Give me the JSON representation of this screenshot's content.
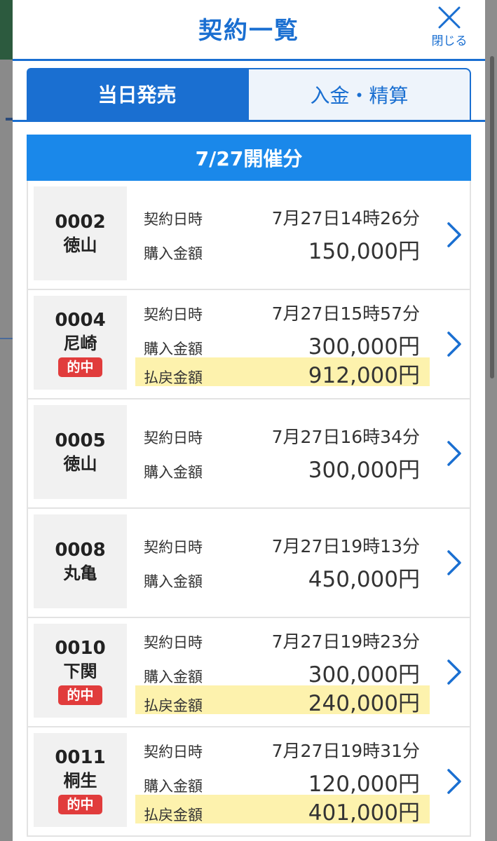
{
  "modal": {
    "title": "契約一覧",
    "close_label": "閉じる"
  },
  "tabs": [
    {
      "label": "当日発売",
      "active": true
    },
    {
      "label": "入金・精算",
      "active": false
    }
  ],
  "date_header": "7/27開催分",
  "labels": {
    "contract_datetime": "契約日時",
    "purchase_amount": "購入金額",
    "payout_amount": "払戻金額",
    "hit": "的中"
  },
  "contracts": [
    {
      "number": "0002",
      "venue": "徳山",
      "hit": false,
      "datetime": "7月27日14時26分",
      "purchase": "150,000円",
      "payout": null
    },
    {
      "number": "0004",
      "venue": "尼崎",
      "hit": true,
      "datetime": "7月27日15時57分",
      "purchase": "300,000円",
      "payout": "912,000円"
    },
    {
      "number": "0005",
      "venue": "徳山",
      "hit": false,
      "datetime": "7月27日16時34分",
      "purchase": "300,000円",
      "payout": null
    },
    {
      "number": "0008",
      "venue": "丸亀",
      "hit": false,
      "datetime": "7月27日19時13分",
      "purchase": "450,000円",
      "payout": null
    },
    {
      "number": "0010",
      "venue": "下関",
      "hit": true,
      "datetime": "7月27日19時23分",
      "purchase": "300,000円",
      "payout": "240,000円"
    },
    {
      "number": "0011",
      "venue": "桐生",
      "hit": true,
      "datetime": "7月27日19時31分",
      "purchase": "120,000円",
      "payout": "401,000円"
    }
  ],
  "colors": {
    "accent": "#1a6fd1",
    "date_header_bg": "#1a88ea",
    "hit_badge": "#e13c3c",
    "payout_highlight": "#fdf2ad"
  }
}
